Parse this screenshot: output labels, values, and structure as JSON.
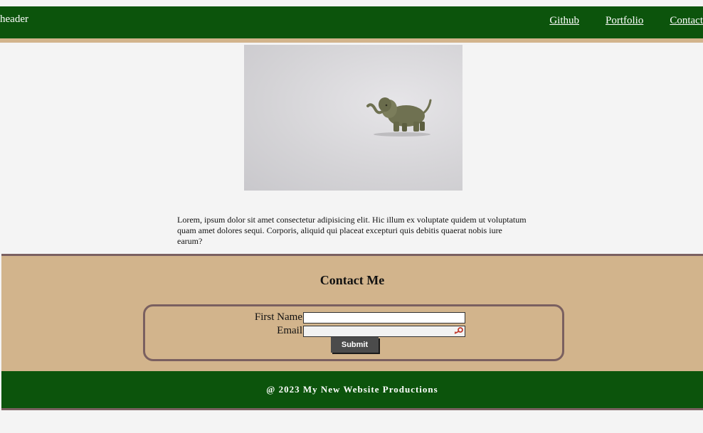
{
  "header": {
    "title": "header",
    "nav": [
      "Github",
      "Portfolio",
      "Contact"
    ]
  },
  "main": {
    "image_icon": "elephant-figurine-photo",
    "intro_text": "Lorem, ipsum dolor sit amet consectetur adipisicing elit. Hic illum ex voluptate quidem ut voluptatum quam amet dolores sequi. Corporis, aliquid qui placeat excepturi quis debitis quaerat nobis iure earum?"
  },
  "contact": {
    "title": "Contact Me",
    "first_name_label": "First Name",
    "first_name_value": "",
    "email_label": "Email",
    "email_value": "",
    "submit_label": "Submit",
    "email_field_icon": "key-icon"
  },
  "footer": {
    "text": "@ 2023 My New Website Productions"
  },
  "colors": {
    "header_bg": "#0c540c",
    "accent_tan": "#d2b48c",
    "border_mauve": "#7a6060",
    "page_bg": "#f4f4f4",
    "button_bg": "#4b4b4b"
  }
}
